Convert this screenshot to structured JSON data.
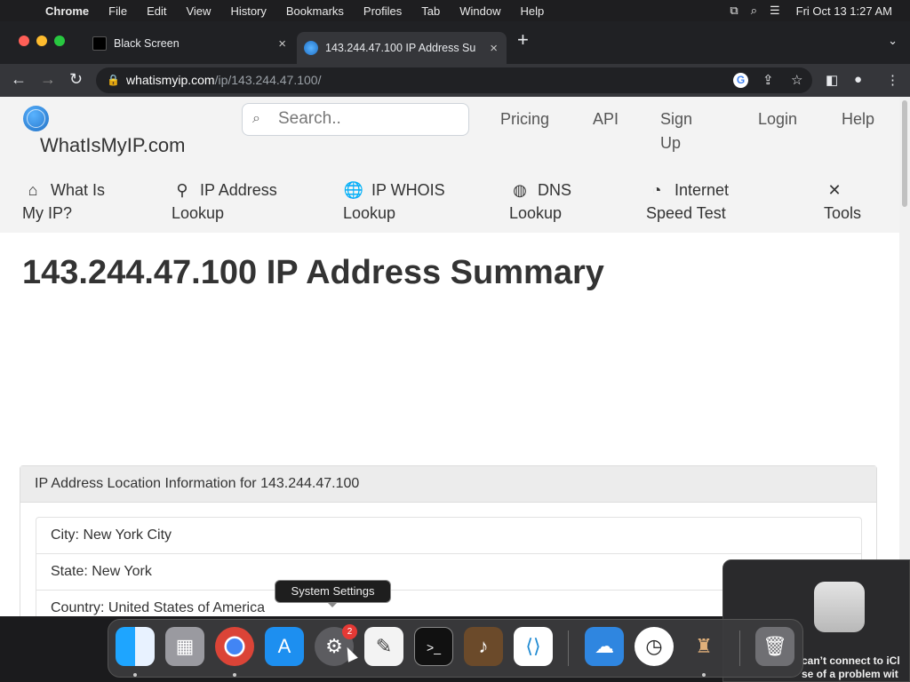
{
  "menubar": {
    "app": "Chrome",
    "items": [
      "File",
      "Edit",
      "View",
      "History",
      "Bookmarks",
      "Profiles",
      "Tab",
      "Window",
      "Help"
    ],
    "clock": "Fri Oct 13  1:27 AM"
  },
  "tabs": [
    {
      "title": "Black Screen",
      "active": false
    },
    {
      "title": "143.244.47.100 IP Address Su",
      "active": true
    }
  ],
  "omnibox": {
    "host": "whatismyip.com",
    "path": "/ip/143.244.47.100/"
  },
  "site": {
    "logo": "WhatIsMyIP.com",
    "search_placeholder": "Search..",
    "top_links": {
      "pricing": "Pricing",
      "api": "API",
      "signup_1": "Sign",
      "signup_2": "Up",
      "login": "Login",
      "help": "Help"
    },
    "nav": {
      "what_1": "What Is",
      "what_2": "My IP?",
      "lookup_1": "IP Address",
      "lookup_2": "Lookup",
      "whois_1": "IP WHOIS",
      "whois_2": "Lookup",
      "dns_1": "DNS",
      "dns_2": "Lookup",
      "speed_1": "Internet",
      "speed_2": "Speed Test",
      "tools": "Tools"
    }
  },
  "main": {
    "heading": "143.244.47.100 IP Address Summary",
    "card_title": "IP Address Location Information for 143.244.47.100",
    "rows": [
      "City: New York City",
      "State: New York",
      "Country: United States of America"
    ]
  },
  "dock": {
    "tooltip": "System Settings",
    "badge": "2"
  },
  "notification": {
    "line1": "can’t connect to iCl",
    "line2": "se of a problem wit"
  }
}
